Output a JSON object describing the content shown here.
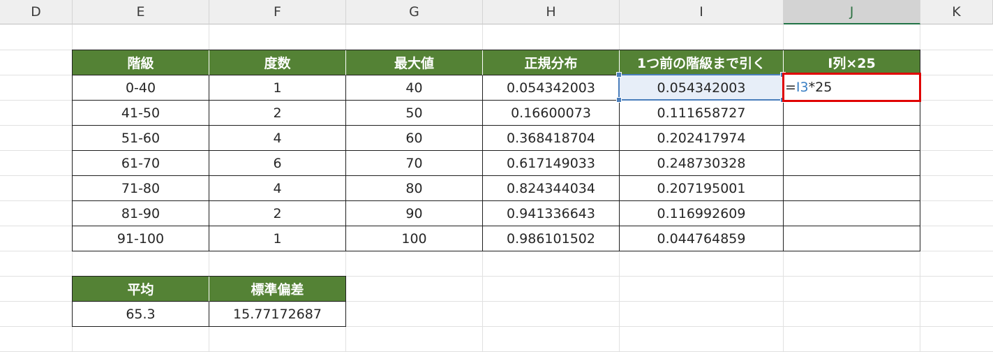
{
  "columns": [
    "D",
    "E",
    "F",
    "G",
    "H",
    "I",
    "J",
    "K"
  ],
  "selected_column": "J",
  "main_table": {
    "headers": [
      "階級",
      "度数",
      "最大値",
      "正規分布",
      "1つ前の階級まで引く",
      "I列×25"
    ],
    "rows": [
      [
        "0-40",
        "1",
        "40",
        "0.054342003",
        "0.054342003"
      ],
      [
        "41-50",
        "2",
        "50",
        "0.16600073",
        "0.111658727"
      ],
      [
        "51-60",
        "4",
        "60",
        "0.368418704",
        "0.202417974"
      ],
      [
        "61-70",
        "6",
        "70",
        "0.617149033",
        "0.248730328"
      ],
      [
        "71-80",
        "4",
        "80",
        "0.824344034",
        "0.207195001"
      ],
      [
        "81-90",
        "2",
        "90",
        "0.941336643",
        "0.116992609"
      ],
      [
        "91-100",
        "1",
        "100",
        "0.986101502",
        "0.044764859"
      ]
    ]
  },
  "editing_cell": {
    "prefix": "=",
    "ref": "I3",
    "suffix": "*25"
  },
  "stats_table": {
    "headers": [
      "平均",
      "標準偏差"
    ],
    "values": [
      "65.3",
      "15.77172687"
    ]
  },
  "colors": {
    "header_green": "#548235",
    "edit_border": "#e00000",
    "selection_blue": "#4a7ebb",
    "ref_blue": "#3a7fc4"
  }
}
